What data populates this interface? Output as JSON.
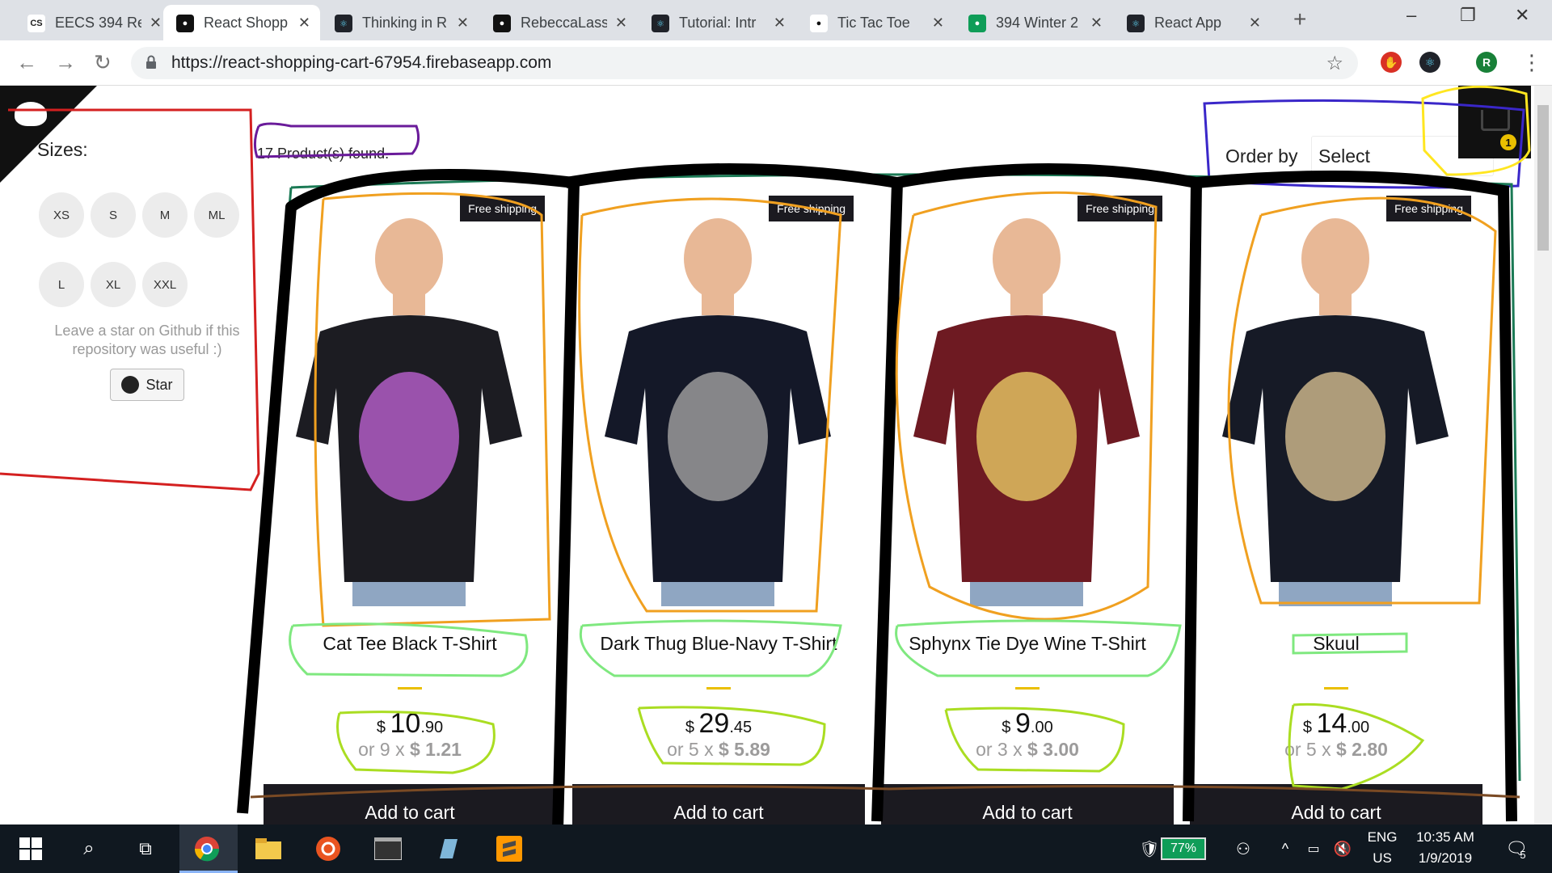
{
  "browser": {
    "tabs": [
      {
        "title": "EECS 394 Re",
        "icon": "csnu-icon",
        "color": "#ffffff",
        "fg": "#222"
      },
      {
        "title": "React Shopp",
        "icon": "react-shopping-icon",
        "color": "#111111",
        "fg": "#fff",
        "active": true
      },
      {
        "title": "Thinking in R",
        "icon": "react-icon",
        "color": "#20232a",
        "fg": "#61dafb"
      },
      {
        "title": "RebeccaLass",
        "icon": "github-icon",
        "color": "#111111",
        "fg": "#fff"
      },
      {
        "title": "Tutorial: Intr",
        "icon": "react-icon",
        "color": "#20232a",
        "fg": "#61dafb"
      },
      {
        "title": "Tic Tac Toe",
        "icon": "codepen-icon",
        "color": "#ffffff",
        "fg": "#111"
      },
      {
        "title": "394 Winter 2",
        "icon": "sheets-icon",
        "color": "#0f9d58",
        "fg": "#fff"
      },
      {
        "title": "React App",
        "icon": "react-icon",
        "color": "#20232a",
        "fg": "#61dafb"
      }
    ],
    "url": "https://react-shopping-cart-67954.firebaseapp.com",
    "profile_initial": "R"
  },
  "sidebar": {
    "title": "Sizes:",
    "sizes": [
      "XS",
      "S",
      "M",
      "ML",
      "L",
      "XL",
      "XXL"
    ],
    "star_note": "Leave a star on Github if this repository was useful :)",
    "star_button": "Star"
  },
  "shelf": {
    "found": "17 Product(s) found.",
    "order_label": "Order by",
    "order_value": "Select",
    "cart_count": "1"
  },
  "products": [
    {
      "title": "Cat Tee Black T-Shirt",
      "currency": "$",
      "int": "10",
      "dec": ".90",
      "installments": "or 9 x",
      "inst_price": "$ 1.21",
      "free": "Free shipping",
      "add": "Add to cart",
      "shirt": "#1c1c22",
      "print": "#b05cc4"
    },
    {
      "title": "Dark Thug Blue-Navy T-Shirt",
      "currency": "$",
      "int": "29",
      "dec": ".45",
      "installments": "or 5 x",
      "inst_price": "$ 5.89",
      "free": "Free shipping",
      "add": "Add to cart",
      "shirt": "#141828",
      "print": "#9a9a9a"
    },
    {
      "title": "Sphynx Tie Dye Wine T-Shirt",
      "currency": "$",
      "int": "9",
      "dec": ".00",
      "installments": "or 3 x",
      "inst_price": "$ 3.00",
      "free": "Free shipping",
      "add": "Add to cart",
      "shirt": "#6e1a22",
      "print": "#e0c060"
    },
    {
      "title": "Skuul",
      "currency": "$",
      "int": "14",
      "dec": ".00",
      "installments": "or 5 x",
      "inst_price": "$ 2.80",
      "free": "Free shipping",
      "add": "Add to cart",
      "shirt": "#161a26",
      "print": "#c9b48a"
    }
  ],
  "taskbar": {
    "battery": "77%",
    "lang1": "ENG",
    "lang2": "US",
    "time": "10:35 AM",
    "date": "1/9/2019",
    "notif_count": "5"
  }
}
